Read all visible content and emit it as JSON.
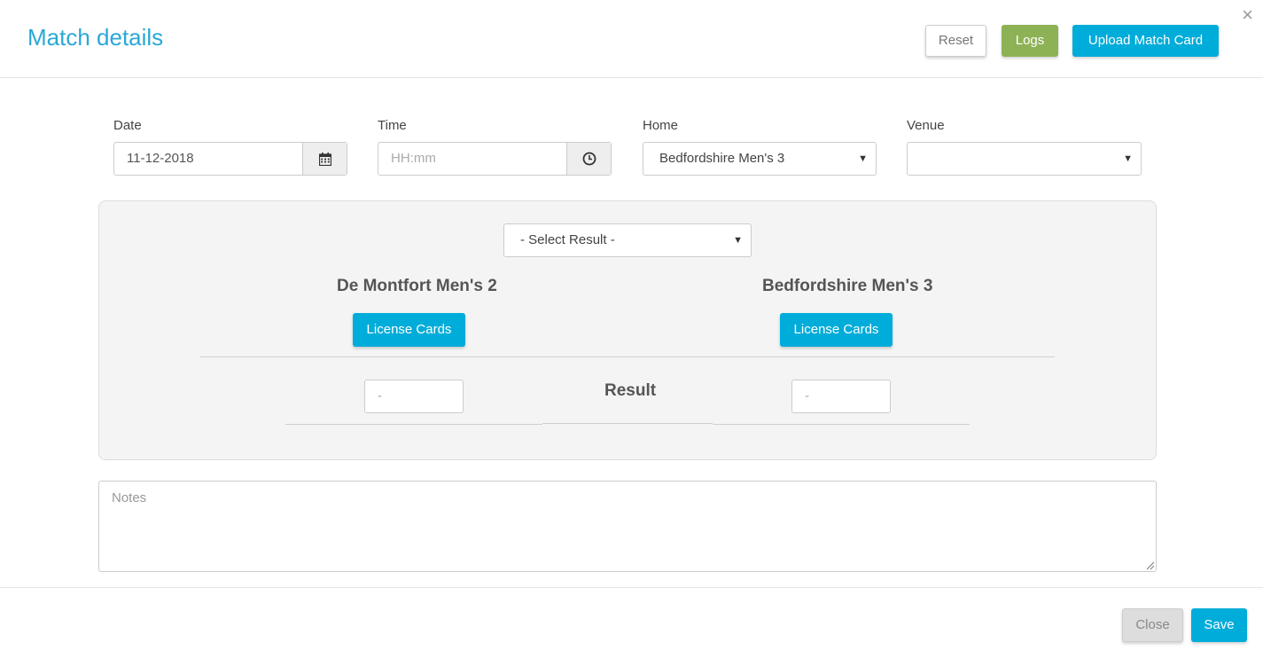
{
  "header": {
    "title": "Match details",
    "close_glyph": "×",
    "reset_label": "Reset",
    "logs_label": "Logs",
    "upload_label": "Upload Match Card"
  },
  "form": {
    "date": {
      "label": "Date",
      "value": "11-12-2018",
      "icon": "calendar-icon"
    },
    "time": {
      "label": "Time",
      "placeholder": "HH:mm",
      "icon": "clock-icon"
    },
    "home": {
      "label": "Home",
      "value": "Bedfordshire Men's 3"
    },
    "venue": {
      "label": "Venue",
      "value": ""
    }
  },
  "result_panel": {
    "select_result": "- Select Result -",
    "home_team": "De Montfort Men's 2",
    "away_team": "Bedfordshire Men's 3",
    "license_label": "License Cards",
    "result_label": "Result",
    "home_score_placeholder": "-",
    "away_score_placeholder": "-"
  },
  "notes": {
    "placeholder": "Notes"
  },
  "footer": {
    "close_label": "Close",
    "save_label": "Save"
  },
  "colors": {
    "accent": "#00acd9",
    "title": "#29a8d6",
    "logs": "#8db255"
  }
}
